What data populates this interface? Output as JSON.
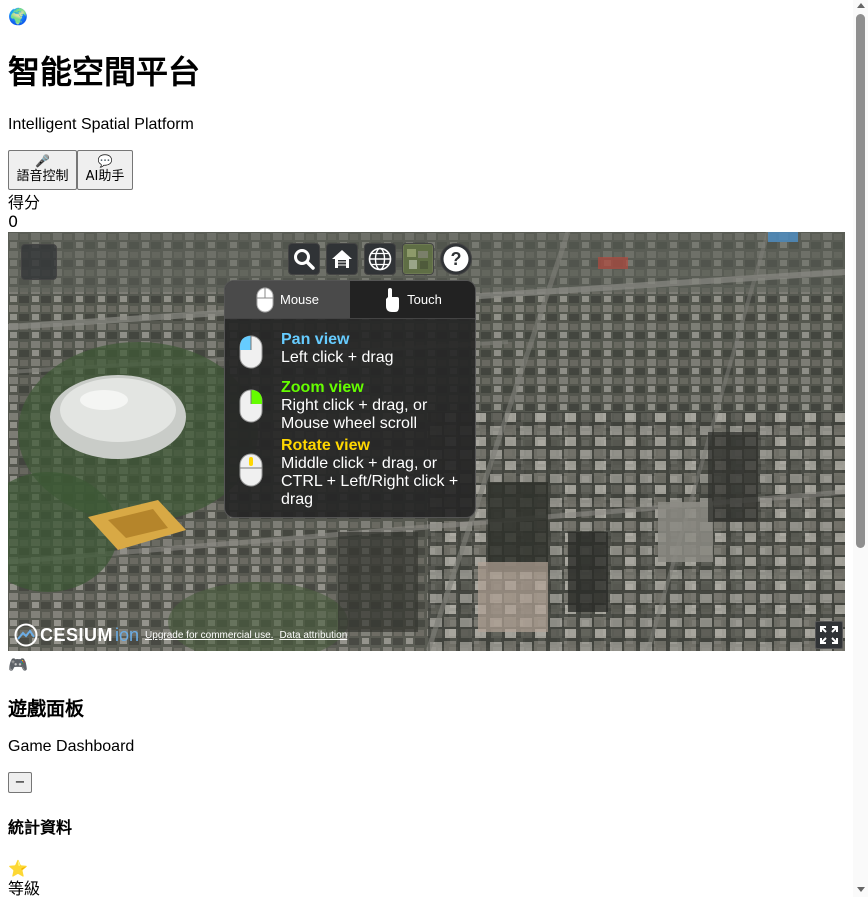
{
  "header": {
    "globe_icon": "🌍",
    "title": "智能空間平台",
    "subtitle": "Intelligent Spatial Platform"
  },
  "controls": {
    "voice_icon": "microphone-icon",
    "voice_label": "語音控制",
    "ai_icon": "speech-bubble-icon",
    "ai_label": "AI助手"
  },
  "score": {
    "label": "得分",
    "value": "0"
  },
  "viewer": {
    "toolbar": [
      "search-icon",
      "home-icon",
      "globe-icon",
      "imagery-icon",
      "help-icon"
    ],
    "help": {
      "tabs": [
        {
          "label": "Mouse",
          "active": true
        },
        {
          "label": "Touch",
          "active": false
        }
      ],
      "items": [
        {
          "heading": "Pan view",
          "color": "#66ccff",
          "lines": [
            "Left click + drag"
          ]
        },
        {
          "heading": "Zoom view",
          "color": "#65fd00",
          "lines": [
            "Right click + drag, or",
            "Mouse wheel scroll"
          ]
        },
        {
          "heading": "Rotate view",
          "color": "#ffd700",
          "lines": [
            "Middle click + drag, or",
            "CTRL + Left/Right click +",
            "drag"
          ]
        }
      ]
    },
    "logo_text": "CESIUM",
    "logo_suffix": "ion",
    "attribution": {
      "upgrade": "Upgrade for commercial use.",
      "data": "Data attribution"
    }
  },
  "dashboard": {
    "icon": "🎮",
    "title": "遊戲面板",
    "subtitle": "Game Dashboard",
    "collapse_label": "−",
    "stats_title": "統計資料",
    "star_icon": "⭐",
    "level_label": "等級"
  }
}
